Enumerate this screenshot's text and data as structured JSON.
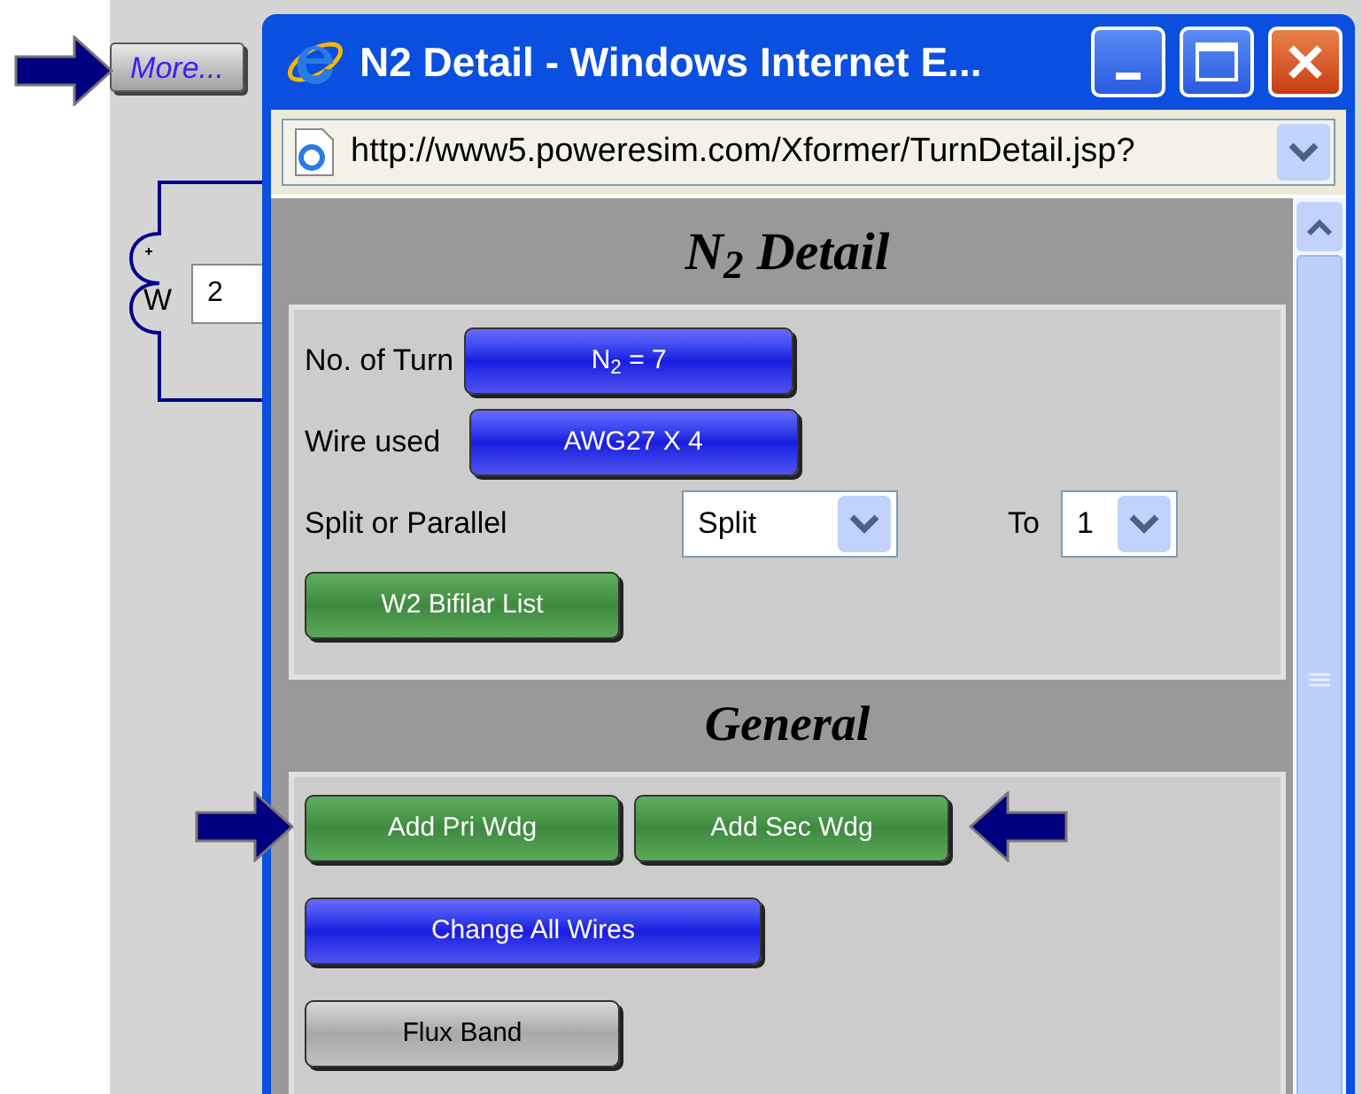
{
  "background": {
    "more_button": "More...",
    "winding_label": "W",
    "winding_value": "2"
  },
  "window": {
    "title": "N2 Detail - Windows Internet E...",
    "url": "http://www5.poweresim.com/Xformer/TurnDetail.jsp?"
  },
  "detail": {
    "heading": "N$_{2}$ Detail",
    "turns_label": "No. of Turn",
    "turns_button": "N$_{2}$ = 7",
    "wire_label": "Wire used",
    "wire_button": "AWG27 X 4",
    "split_label": "Split or Parallel",
    "split_value": "Split",
    "to_label": "To",
    "to_value": "1",
    "bifilar_button": "W2 Bifilar List"
  },
  "general": {
    "heading": "General",
    "rows": [
      [
        {
          "label": "Add Pri Wdg",
          "kind": "green"
        },
        {
          "label": "Add Sec Wdg",
          "kind": "green"
        }
      ],
      [
        {
          "label": "Change All Wires",
          "kind": "blue"
        }
      ],
      [
        {
          "label": "Flux Band",
          "kind": "gray"
        }
      ]
    ]
  }
}
